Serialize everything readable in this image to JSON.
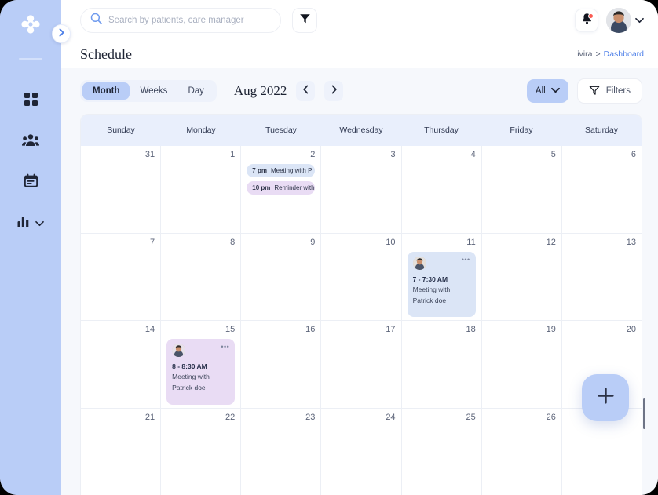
{
  "sidebar": {
    "logo_icon": "clover-logo-icon",
    "collapse_icon": "chevron-right-icon",
    "items": [
      {
        "icon": "grid-dashboard-icon",
        "name": "dashboard"
      },
      {
        "icon": "people-group-icon",
        "name": "patients"
      },
      {
        "icon": "calendar-icon",
        "name": "schedule"
      },
      {
        "icon": "bar-chart-icon",
        "name": "reports",
        "has_chevron": true
      }
    ]
  },
  "topbar": {
    "search": {
      "placeholder": "Search by patients, care manager",
      "value": "",
      "icon": "search-icon"
    },
    "filter_icon": "funnel-icon",
    "bell_icon": "bell-icon",
    "avatar_chevron_icon": "chevron-down-icon"
  },
  "subbar": {
    "title": "Schedule",
    "breadcrumb": {
      "root": "ivira",
      "separator": ">",
      "current": "Dashboard"
    }
  },
  "toolbar": {
    "views": [
      {
        "label": "Month",
        "active": true
      },
      {
        "label": "Weeks",
        "active": false
      },
      {
        "label": "Day",
        "active": false
      }
    ],
    "period_label": "Aug 2022",
    "prev_icon": "chevron-left-icon",
    "next_icon": "chevron-right-icon",
    "all_dropdown": {
      "label": "All",
      "icon": "chevron-down-icon"
    },
    "filters_button": {
      "label": "Filters",
      "icon": "funnel-icon"
    }
  },
  "calendar": {
    "day_headers": [
      "Sunday",
      "Monday",
      "Tuesday",
      "Wednesday",
      "Thursday",
      "Friday",
      "Saturday"
    ],
    "weeks": [
      [
        {
          "day": "31"
        },
        {
          "day": "1"
        },
        {
          "day": "2",
          "chips": [
            {
              "time": "7 pm",
              "title": "Meeting with P",
              "color": "blue"
            },
            {
              "time": "10 pm",
              "title": "Reminder with",
              "color": "purple"
            }
          ]
        },
        {
          "day": "3"
        },
        {
          "day": "4"
        },
        {
          "day": "5"
        },
        {
          "day": "6"
        }
      ],
      [
        {
          "day": "7"
        },
        {
          "day": "8"
        },
        {
          "day": "9"
        },
        {
          "day": "10"
        },
        {
          "day": "11",
          "card": {
            "time": "7 - 7:30 AM",
            "title_line1": "Meeting with",
            "title_line2": "Patrick doe",
            "color": "blue",
            "menu_icon": "more-dots-icon"
          }
        },
        {
          "day": "12"
        },
        {
          "day": "13"
        }
      ],
      [
        {
          "day": "14"
        },
        {
          "day": "15",
          "card": {
            "time": "8 - 8:30 AM",
            "title_line1": "Meeting with",
            "title_line2": "Patrick doe",
            "color": "purple",
            "menu_icon": "more-dots-icon"
          }
        },
        {
          "day": "16"
        },
        {
          "day": "17"
        },
        {
          "day": "18"
        },
        {
          "day": "19"
        },
        {
          "day": "20"
        }
      ],
      [
        {
          "day": "21"
        },
        {
          "day": "22"
        },
        {
          "day": "23"
        },
        {
          "day": "24"
        },
        {
          "day": "25"
        },
        {
          "day": "26"
        },
        {
          "day": ""
        }
      ]
    ]
  },
  "fab": {
    "icon": "plus-icon"
  },
  "colors": {
    "sidebar": "#b9cdf7",
    "accent": "#b9cdf7",
    "link": "#4d7fe8",
    "event_blue": "#dbe5f6",
    "event_purple": "#e9dcf4",
    "notification_dot": "#fa5a52",
    "calendar_header": "#e9effc"
  }
}
